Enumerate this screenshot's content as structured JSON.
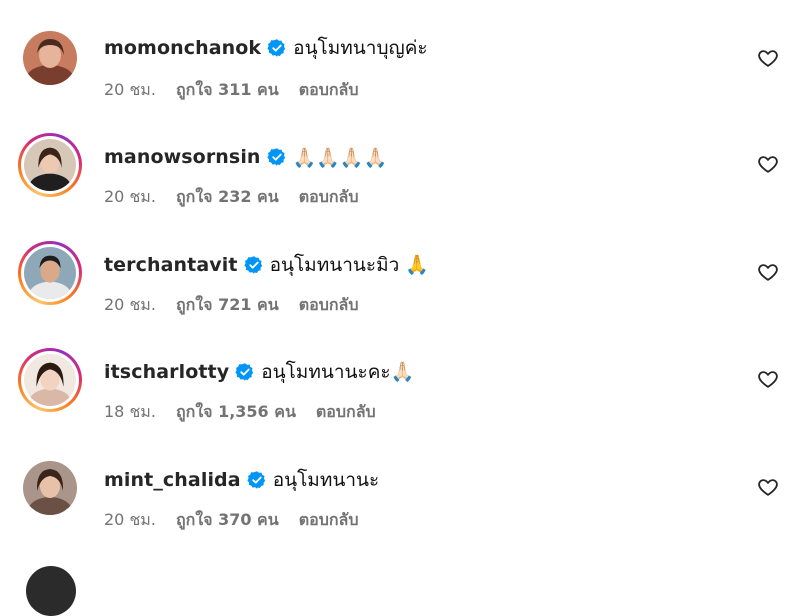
{
  "comments": [
    {
      "username": "momonchanok",
      "text": "อนุโมทนาบุญค่ะ",
      "time": "20 ชม.",
      "likes": "ถูกใจ 311 คน",
      "reply": "ตอบกลับ",
      "story_ring": false
    },
    {
      "username": "manowsornsin",
      "text": "🙏🏻🙏🏻🙏🏻🙏🏻",
      "time": "20 ชม.",
      "likes": "ถูกใจ 232 คน",
      "reply": "ตอบกลับ",
      "story_ring": true
    },
    {
      "username": "terchantavit",
      "text": "อนุโมทนานะมิว 🙏",
      "time": "20 ชม.",
      "likes": "ถูกใจ 721 คน",
      "reply": "ตอบกลับ",
      "story_ring": true
    },
    {
      "username": "itscharlotty",
      "text": "อนุโมทนานะคะ🙏🏻",
      "time": "18 ชม.",
      "likes": "ถูกใจ 1,356 คน",
      "reply": "ตอบกลับ",
      "story_ring": true
    },
    {
      "username": "mint_chalida",
      "text": "อนุโมทนานะ",
      "time": "20 ชม.",
      "likes": "ถูกใจ 370 คน",
      "reply": "ตอบกลับ",
      "story_ring": false
    }
  ],
  "icons": {
    "verified": "verified-badge-icon",
    "like": "heart-outline-icon"
  },
  "colors": {
    "verified_blue": "#0095f6",
    "meta_gray": "#737373",
    "username": "#262626"
  }
}
